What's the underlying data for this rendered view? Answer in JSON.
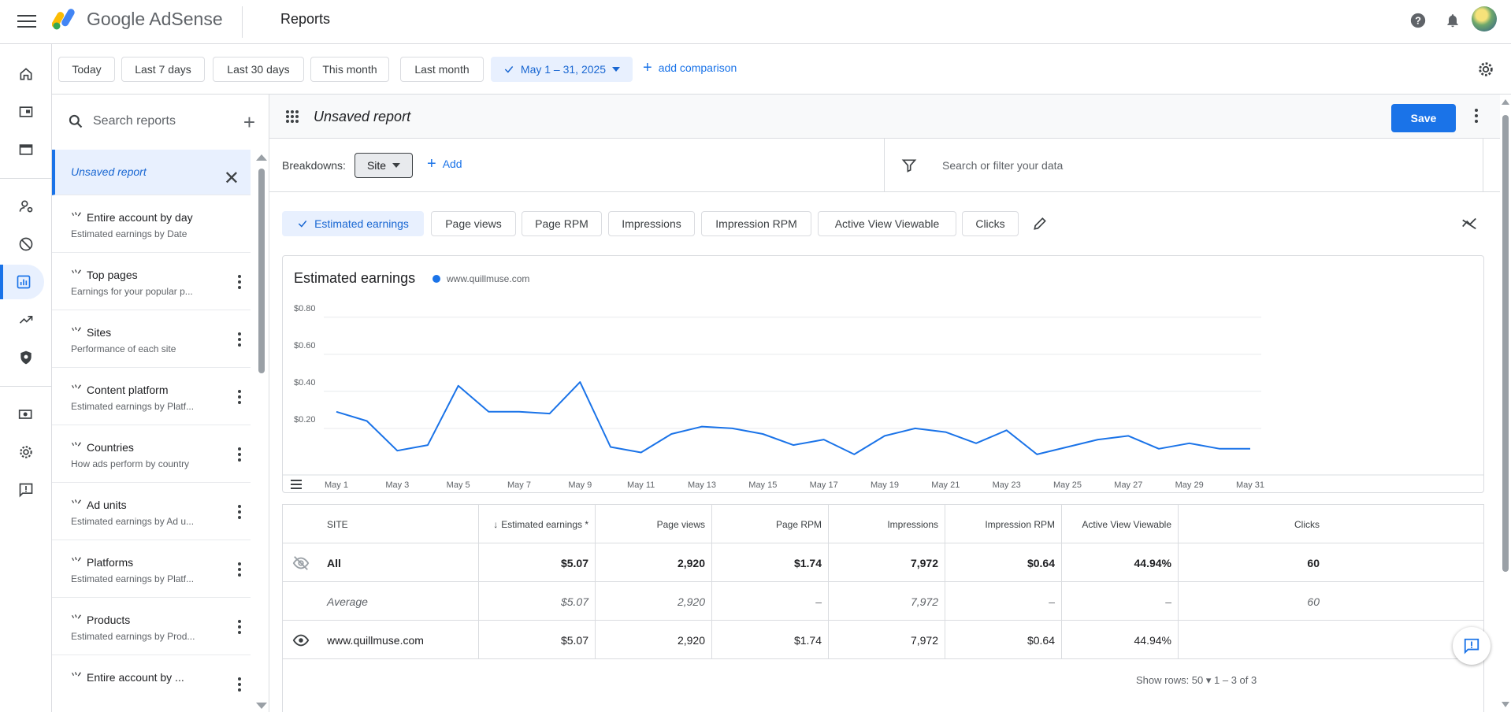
{
  "header": {
    "brand_google": "Google",
    "brand_product": "AdSense",
    "page_title": "Reports"
  },
  "date_range": {
    "chips": [
      "Today",
      "Last 7 days",
      "Last 30 days",
      "This month",
      "Last month"
    ],
    "selected": "May 1 – 31, 2025",
    "add_comparison": "add comparison"
  },
  "sidebar": {
    "search_placeholder": "Search reports",
    "items": [
      {
        "title": "Unsaved report",
        "subtitle": ""
      },
      {
        "title": "Entire account by day",
        "subtitle": "Estimated earnings by Date"
      },
      {
        "title": "Top pages",
        "subtitle": "Earnings for your popular p..."
      },
      {
        "title": "Sites",
        "subtitle": "Performance of each site"
      },
      {
        "title": "Content platform",
        "subtitle": "Estimated earnings by Platf..."
      },
      {
        "title": "Countries",
        "subtitle": "How ads perform by country"
      },
      {
        "title": "Ad units",
        "subtitle": "Estimated earnings by Ad u..."
      },
      {
        "title": "Platforms",
        "subtitle": "Estimated earnings by Platf..."
      },
      {
        "title": "Products",
        "subtitle": "Estimated earnings by Prod..."
      },
      {
        "title": "Entire account by ...",
        "subtitle": ""
      }
    ]
  },
  "report": {
    "title": "Unsaved report",
    "save_label": "Save",
    "breakdowns_label": "Breakdowns:",
    "breakdown_chip": "Site",
    "add_label": "Add",
    "filter_placeholder": "Search or filter your data",
    "metric_chips": [
      "Estimated earnings",
      "Page views",
      "Page RPM",
      "Impressions",
      "Impression RPM",
      "Active View Viewable",
      "Clicks"
    ]
  },
  "chart_data": {
    "type": "line",
    "title": "Estimated earnings",
    "series": [
      {
        "name": "www.quillmuse.com",
        "color": "#1a73e8",
        "values": [
          0.29,
          0.24,
          0.08,
          0.11,
          0.43,
          0.29,
          0.29,
          0.28,
          0.45,
          0.1,
          0.07,
          0.17,
          0.21,
          0.2,
          0.17,
          0.11,
          0.14,
          0.06,
          0.16,
          0.2,
          0.18,
          0.12,
          0.19,
          0.06,
          0.1,
          0.14,
          0.16,
          0.09,
          0.12,
          0.09,
          0.09
        ]
      }
    ],
    "x": [
      "May 1",
      "May 2",
      "May 3",
      "May 4",
      "May 5",
      "May 6",
      "May 7",
      "May 8",
      "May 9",
      "May 10",
      "May 11",
      "May 12",
      "May 13",
      "May 14",
      "May 15",
      "May 16",
      "May 17",
      "May 18",
      "May 19",
      "May 20",
      "May 21",
      "May 22",
      "May 23",
      "May 24",
      "May 25",
      "May 26",
      "May 27",
      "May 28",
      "May 29",
      "May 30",
      "May 31"
    ],
    "x_tick_labels": [
      "May 1",
      "May 3",
      "May 5",
      "May 7",
      "May 9",
      "May 11",
      "May 13",
      "May 15",
      "May 17",
      "May 19",
      "May 21",
      "May 23",
      "May 25",
      "May 27",
      "May 29",
      "May 31"
    ],
    "y_tick_labels": [
      "$0.20",
      "$0.40",
      "$0.60",
      "$0.80"
    ],
    "ylim": [
      0,
      0.85
    ],
    "grid": true,
    "legend": "top-left"
  },
  "table": {
    "headers": [
      "SITE",
      "Estimated earnings *",
      "Page views",
      "Page RPM",
      "Impressions",
      "Impression RPM",
      "Active View Viewable",
      "Clicks"
    ],
    "rows": [
      {
        "site": "All",
        "cells": [
          "$5.07",
          "2,920",
          "$1.74",
          "7,972",
          "$0.64",
          "44.94%",
          "60"
        ]
      },
      {
        "site": "Average",
        "cells": [
          "$5.07",
          "2,920",
          "–",
          "7,972",
          "–",
          "–",
          "60"
        ]
      },
      {
        "site": "www.quillmuse.com",
        "cells": [
          "$5.07",
          "2,920",
          "$1.74",
          "7,972",
          "$0.64",
          "44.94%",
          ""
        ]
      }
    ],
    "pager": "Show rows:   50  ▾     1 – 3 of 3"
  },
  "colors": {
    "accent": "#1a73e8",
    "selected_bg": "#e8f0fe"
  }
}
